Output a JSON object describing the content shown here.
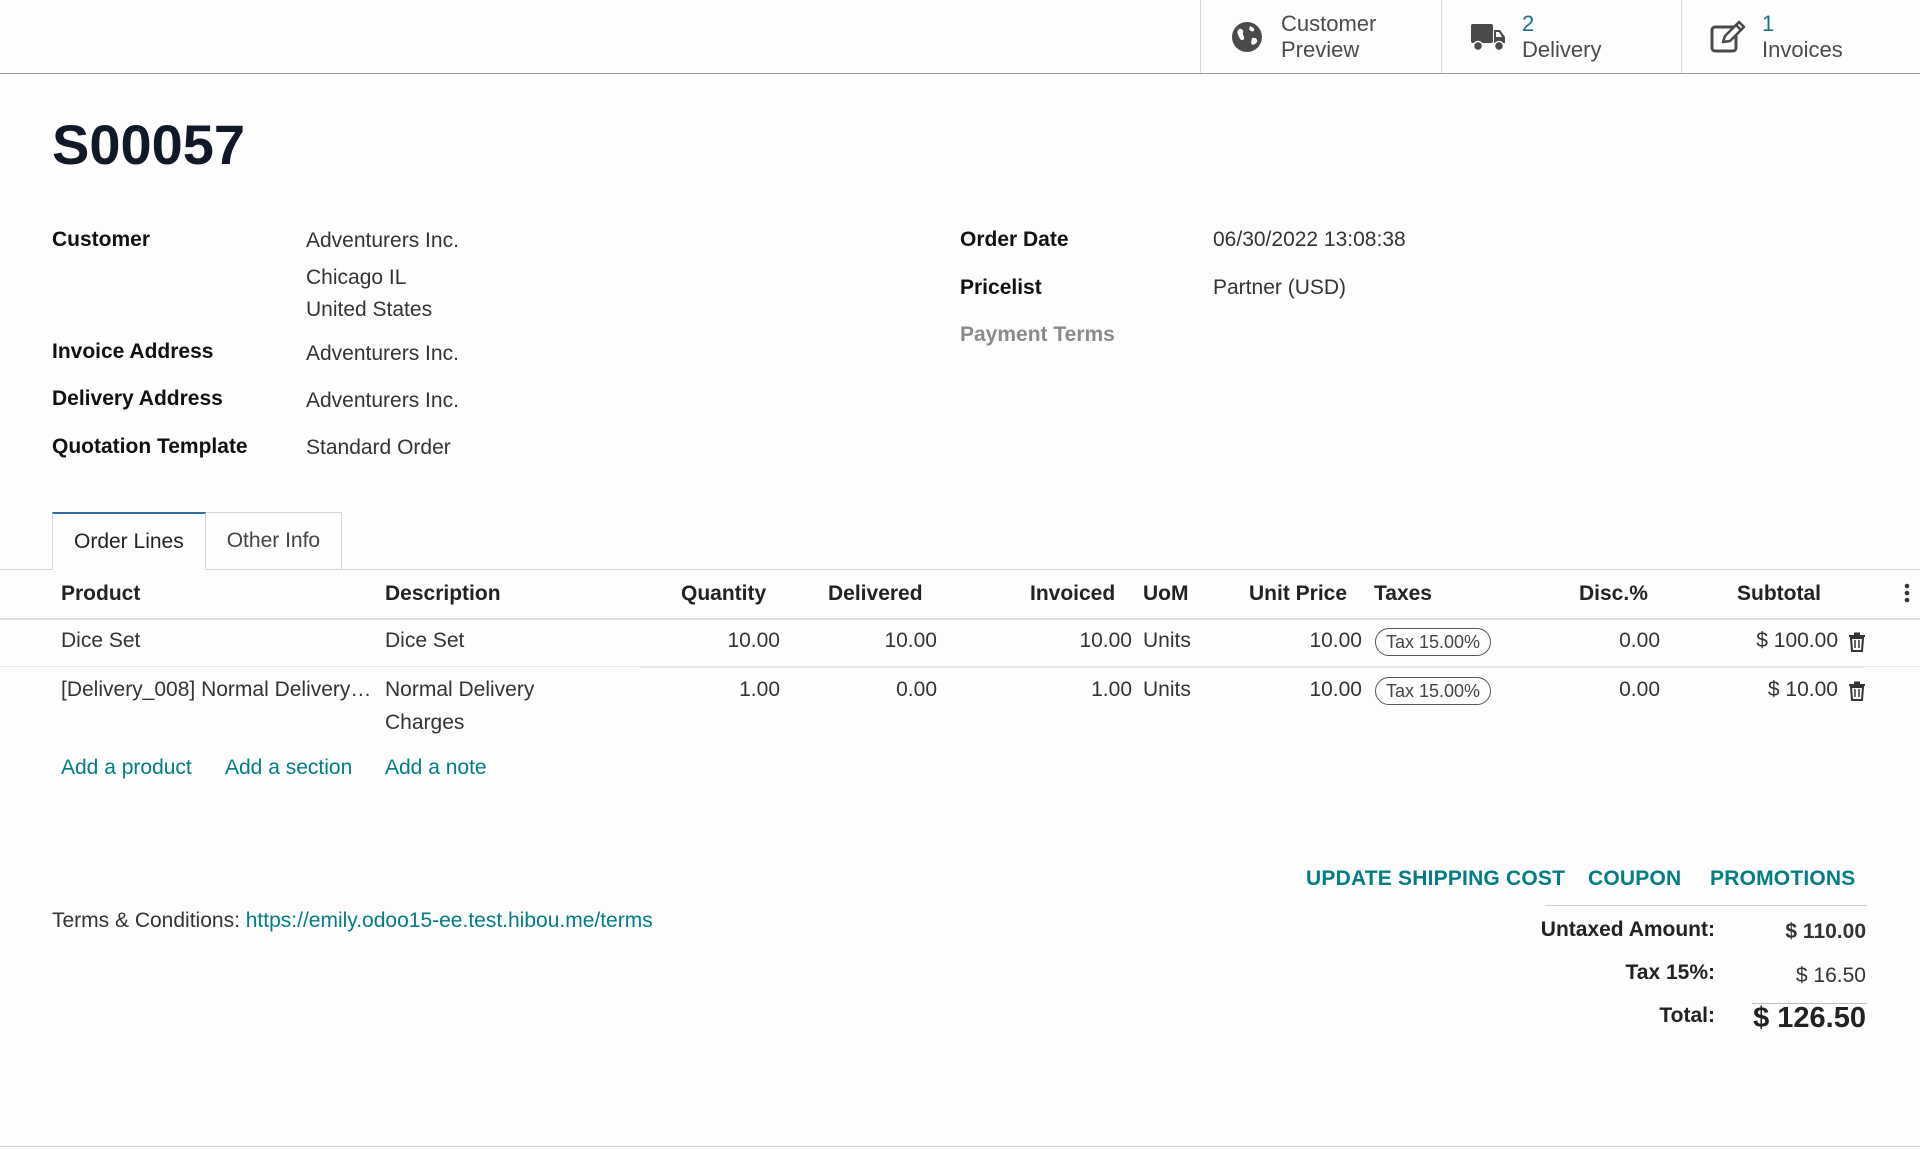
{
  "smart_buttons": [
    {
      "icon": "globe-icon",
      "number": "",
      "line1": "Customer",
      "line2": "Preview"
    },
    {
      "icon": "truck-icon",
      "number": "2",
      "line1": "",
      "line2": "Delivery"
    },
    {
      "icon": "edit-icon",
      "number": "1",
      "line1": "",
      "line2": "Invoices"
    }
  ],
  "order": {
    "name": "S00057",
    "customer_label": "Customer",
    "customer_name": "Adventurers Inc.",
    "customer_city": "Chicago IL",
    "customer_country": "United States",
    "invoice_address_label": "Invoice Address",
    "invoice_address": "Adventurers Inc.",
    "delivery_address_label": "Delivery Address",
    "delivery_address": "Adventurers Inc.",
    "quotation_template_label": "Quotation Template",
    "quotation_template": "Standard Order",
    "order_date_label": "Order Date",
    "order_date": "06/30/2022 13:08:38",
    "pricelist_label": "Pricelist",
    "pricelist": "Partner (USD)",
    "payment_terms_label": "Payment Terms"
  },
  "tabs": [
    "Order Lines",
    "Other Info"
  ],
  "table": {
    "headers": {
      "product": "Product",
      "description": "Description",
      "quantity": "Quantity",
      "delivered": "Delivered",
      "invoiced": "Invoiced",
      "uom": "UoM",
      "unit_price": "Unit Price",
      "taxes": "Taxes",
      "disc": "Disc.%",
      "subtotal": "Subtotal"
    },
    "rows": [
      {
        "product": "Dice Set",
        "description": "Dice Set",
        "description2": "",
        "quantity": "10.00",
        "delivered": "10.00",
        "invoiced": "10.00",
        "uom": "Units",
        "unit_price": "10.00",
        "tax": "Tax 15.00%",
        "disc": "0.00",
        "subtotal": "$ 100.00"
      },
      {
        "product": "[Delivery_008] Normal Delivery…",
        "description": "Normal Delivery",
        "description2": "Charges",
        "quantity": "1.00",
        "delivered": "0.00",
        "invoiced": "1.00",
        "uom": "Units",
        "unit_price": "10.00",
        "tax": "Tax 15.00%",
        "disc": "0.00",
        "subtotal": "$ 10.00"
      }
    ],
    "add_product": "Add a product",
    "add_section": "Add a section",
    "add_note": "Add a note"
  },
  "actions": {
    "update_shipping": "UPDATE SHIPPING COST",
    "coupon": "COUPON",
    "promotions": "PROMOTIONS"
  },
  "terms": {
    "label": "Terms & Conditions:",
    "url": "https://emily.odoo15-ee.test.hibou.me/terms"
  },
  "totals": {
    "untaxed_label": "Untaxed Amount:",
    "untaxed": "$ 110.00",
    "tax_label": "Tax 15%:",
    "tax": "$ 16.50",
    "total_label": "Total:",
    "total": "$ 126.50"
  },
  "colors": {
    "link": "#017e84",
    "smart_number": "#1d6f96",
    "title": "#111827"
  }
}
